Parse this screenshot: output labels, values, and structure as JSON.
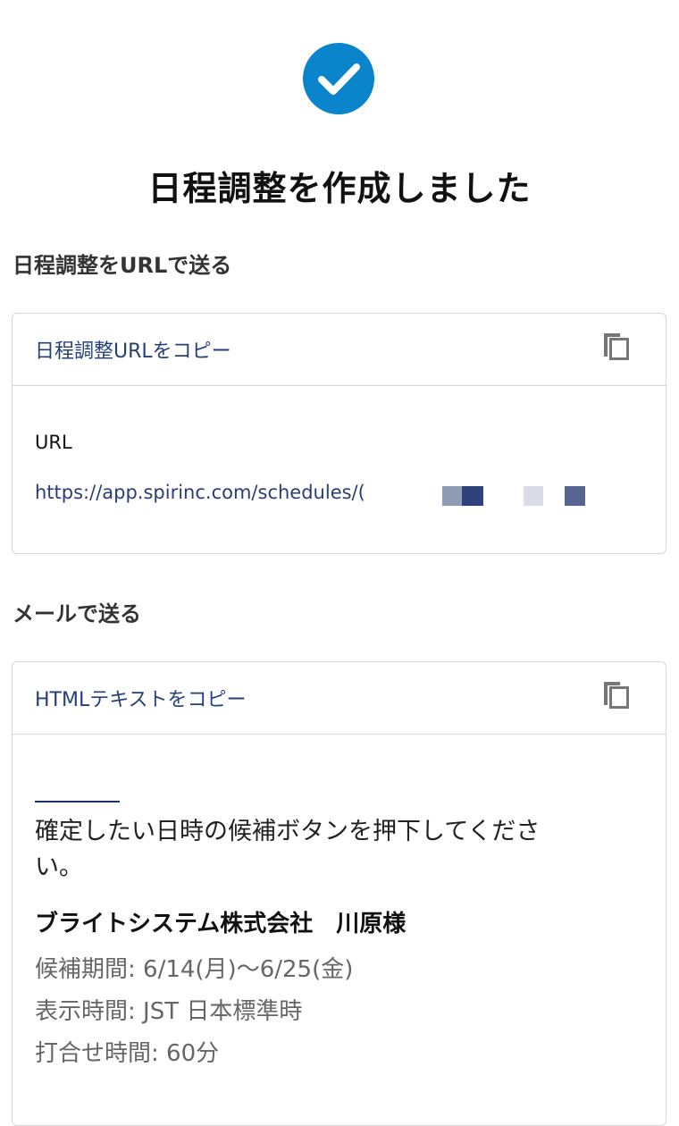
{
  "header": {
    "icon": "check-circle-icon",
    "title": "日程調整を作成しました"
  },
  "url_section": {
    "heading": "日程調整をURLで送る",
    "copy_label": "日程調整URLをコピー",
    "copy_icon": "copy-icon",
    "field_label": "URL",
    "url": "https://app.spirinc.com/schedules/("
  },
  "mail_section": {
    "heading": "メールで送る",
    "copy_label": "HTMLテキストをコピー",
    "copy_icon": "copy-icon",
    "message": "確定したい日時の候補ボタンを押下してください。",
    "company": "ブライトシステム株式会社　川原様",
    "period": "候補期間: 6/14(月)〜6/25(金)",
    "timezone": "表示時間: JST 日本標準時",
    "duration": "打合せ時間: 60分"
  },
  "colors": {
    "accent": "#0a85cc",
    "link": "#24407a",
    "border": "#d7d7d7"
  }
}
